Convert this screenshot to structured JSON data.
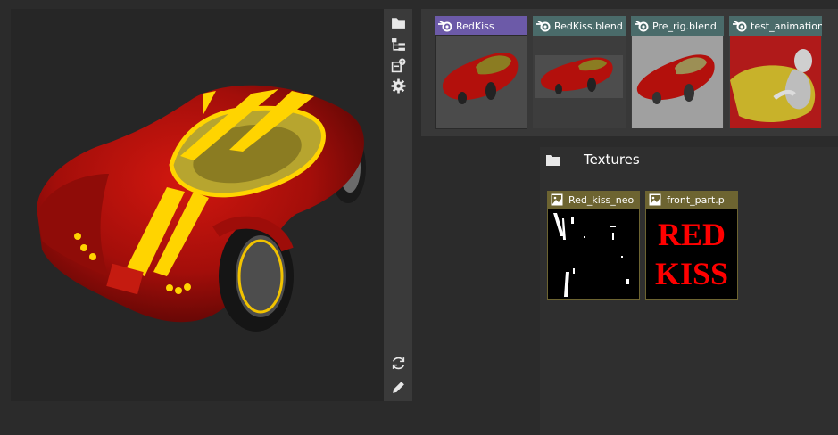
{
  "colors": {
    "active_file_header": "#6c5aa8",
    "file_header": "#4a6b6a",
    "texture_header": "#7a6b2f",
    "car_red": "#b3100c",
    "car_yellow": "#ffd400"
  },
  "toolbar": {
    "top_icons": [
      "folder-icon",
      "hierarchy-icon",
      "add-item-icon",
      "settings-gear-icon"
    ],
    "bottom_icons": [
      "refresh-icon",
      "edit-pencil-icon"
    ]
  },
  "files": [
    {
      "name": "RedKiss",
      "icon": "blender-icon",
      "active": true
    },
    {
      "name": "RedKiss.blend",
      "icon": "blender-icon",
      "active": false
    },
    {
      "name": "Pre_rig.blend",
      "icon": "blender-icon",
      "active": false
    },
    {
      "name": "test_animation.",
      "icon": "blender-icon",
      "active": false
    }
  ],
  "textures": {
    "title": "Textures",
    "items": [
      {
        "name": "Red_kiss_neo",
        "icon": "image-icon"
      },
      {
        "name": "front_part.p",
        "icon": "image-icon",
        "preview_text": [
          "RED",
          "KISS"
        ]
      }
    ]
  }
}
